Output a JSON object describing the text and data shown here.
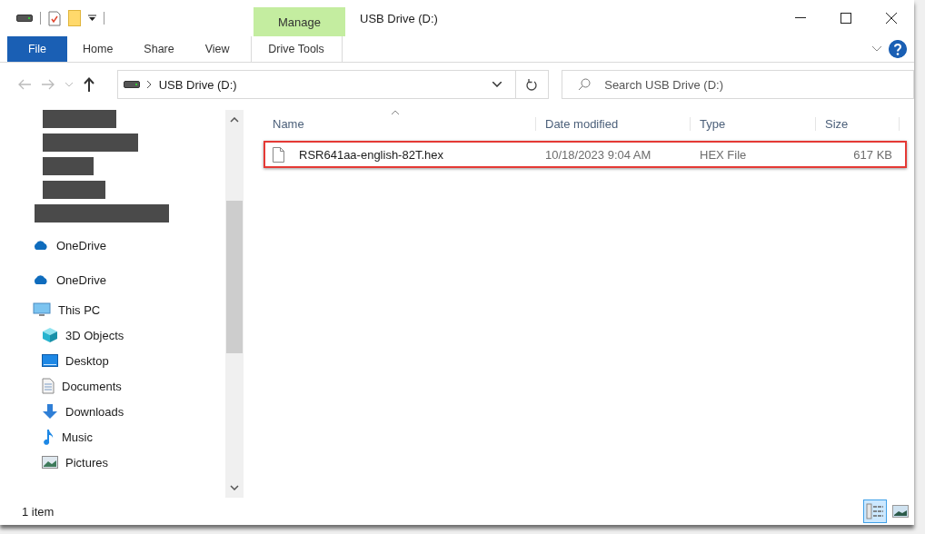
{
  "window": {
    "title": "USB Drive (D:)"
  },
  "contextual_tab_group": {
    "label": "Manage"
  },
  "ribbon_tabs": [
    {
      "label": "File",
      "kind": "file",
      "selected": false
    },
    {
      "label": "Home",
      "kind": "normal",
      "selected": false
    },
    {
      "label": "Share",
      "kind": "normal",
      "selected": false
    },
    {
      "label": "View",
      "kind": "normal",
      "selected": false
    },
    {
      "label": "Drive Tools",
      "kind": "contextual",
      "selected": false
    }
  ],
  "address_bar": {
    "path": [
      "USB Drive (D:)"
    ]
  },
  "search": {
    "placeholder": "Search USB Drive (D:)"
  },
  "sidebar": {
    "items": [
      {
        "kind": "redacted"
      },
      {
        "kind": "redacted"
      },
      {
        "kind": "redacted"
      },
      {
        "kind": "redacted"
      },
      {
        "kind": "redacted"
      },
      {
        "kind": "onedrive",
        "label": "OneDrive"
      },
      {
        "kind": "onedrive",
        "label": "OneDrive"
      },
      {
        "kind": "pc",
        "label": "This PC",
        "children": [
          {
            "kind": "objects3d",
            "label": "3D Objects"
          },
          {
            "kind": "desktop",
            "label": "Desktop"
          },
          {
            "kind": "documents",
            "label": "Documents"
          },
          {
            "kind": "downloads",
            "label": "Downloads"
          },
          {
            "kind": "music",
            "label": "Music"
          },
          {
            "kind": "pictures",
            "label": "Pictures"
          }
        ]
      }
    ]
  },
  "file_list": {
    "columns": [
      "Name",
      "Date modified",
      "Type",
      "Size"
    ],
    "rows": [
      {
        "name": "RSR641aa-english-82T.hex",
        "date_modified": "10/18/2023 9:04 AM",
        "type": "HEX File",
        "size": "617 KB",
        "annotated": true
      }
    ]
  },
  "status_bar": {
    "text": "1 item",
    "views": [
      {
        "kind": "details",
        "selected": true
      },
      {
        "kind": "large_icons",
        "selected": false
      }
    ]
  }
}
